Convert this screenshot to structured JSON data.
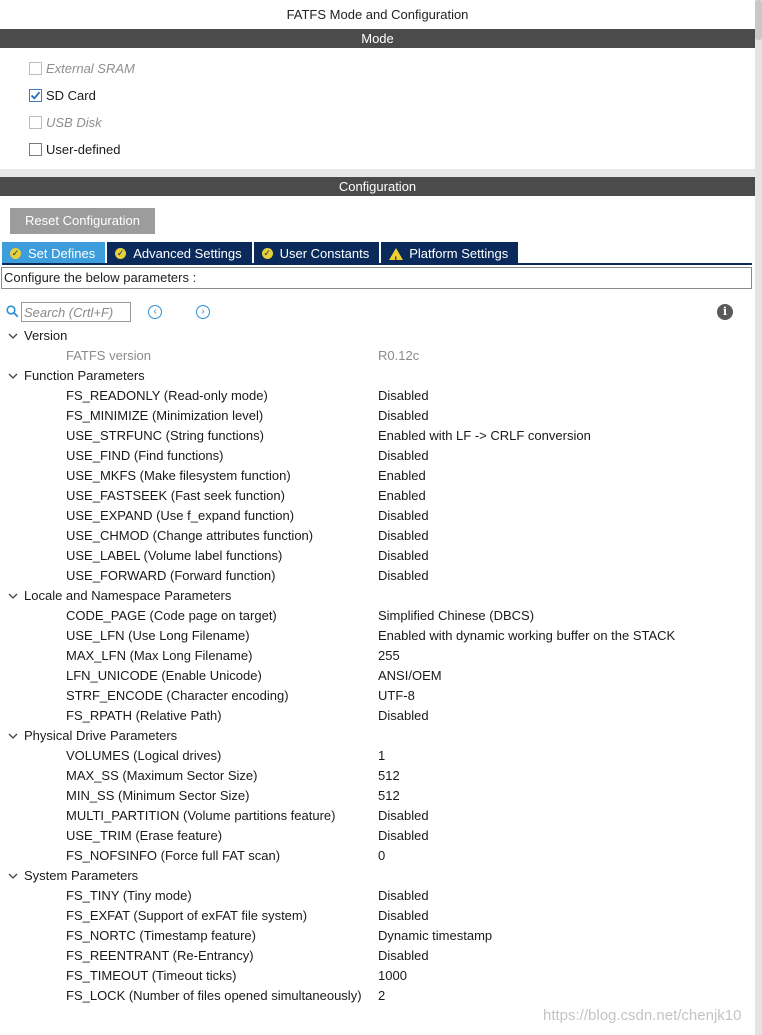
{
  "window": {
    "title": "FATFS Mode and Configuration"
  },
  "mode": {
    "header": "Mode",
    "items": [
      {
        "label": "External SRAM",
        "checked": false,
        "enabled": false
      },
      {
        "label": "SD Card",
        "checked": true,
        "enabled": true
      },
      {
        "label": "USB Disk",
        "checked": false,
        "enabled": false
      },
      {
        "label": "User-defined",
        "checked": false,
        "enabled": true
      }
    ]
  },
  "configuration": {
    "header": "Configuration",
    "reset_label": "Reset Configuration",
    "tabs": [
      {
        "label": "Set Defines",
        "icon": "check-circle-icon",
        "active": true
      },
      {
        "label": "Advanced Settings",
        "icon": "check-circle-icon",
        "active": false
      },
      {
        "label": "User Constants",
        "icon": "check-circle-icon",
        "active": false
      },
      {
        "label": "Platform Settings",
        "icon": "warning-icon",
        "active": false
      }
    ],
    "description": "Configure the below parameters :",
    "search_placeholder": "Search (Crtl+F)"
  },
  "tree": [
    {
      "group": "Version",
      "params": [
        {
          "name": "FATFS version",
          "value": "R0.12c",
          "readonly": true
        }
      ]
    },
    {
      "group": "Function Parameters",
      "params": [
        {
          "name": "FS_READONLY (Read-only mode)",
          "value": "Disabled"
        },
        {
          "name": "FS_MINIMIZE (Minimization level)",
          "value": "Disabled"
        },
        {
          "name": "USE_STRFUNC (String functions)",
          "value": "Enabled with LF -> CRLF conversion"
        },
        {
          "name": "USE_FIND (Find functions)",
          "value": "Disabled"
        },
        {
          "name": "USE_MKFS (Make filesystem function)",
          "value": "Enabled"
        },
        {
          "name": "USE_FASTSEEK (Fast seek function)",
          "value": "Enabled"
        },
        {
          "name": "USE_EXPAND (Use f_expand function)",
          "value": "Disabled"
        },
        {
          "name": "USE_CHMOD (Change attributes function)",
          "value": "Disabled"
        },
        {
          "name": "USE_LABEL (Volume label functions)",
          "value": "Disabled"
        },
        {
          "name": "USE_FORWARD (Forward function)",
          "value": "Disabled"
        }
      ]
    },
    {
      "group": "Locale and Namespace Parameters",
      "params": [
        {
          "name": "CODE_PAGE (Code page on target)",
          "value": "Simplified Chinese (DBCS)"
        },
        {
          "name": "USE_LFN (Use Long Filename)",
          "value": "Enabled with dynamic working buffer on the STACK"
        },
        {
          "name": "MAX_LFN (Max Long Filename)",
          "value": "255"
        },
        {
          "name": "LFN_UNICODE (Enable Unicode)",
          "value": "ANSI/OEM"
        },
        {
          "name": "STRF_ENCODE (Character encoding)",
          "value": "UTF-8"
        },
        {
          "name": "FS_RPATH (Relative Path)",
          "value": "Disabled"
        }
      ]
    },
    {
      "group": "Physical Drive Parameters",
      "params": [
        {
          "name": "VOLUMES (Logical drives)",
          "value": "1"
        },
        {
          "name": "MAX_SS (Maximum Sector Size)",
          "value": "512"
        },
        {
          "name": "MIN_SS (Minimum Sector Size)",
          "value": "512"
        },
        {
          "name": "MULTI_PARTITION (Volume partitions feature)",
          "value": "Disabled"
        },
        {
          "name": "USE_TRIM (Erase feature)",
          "value": "Disabled"
        },
        {
          "name": "FS_NOFSINFO (Force full FAT scan)",
          "value": "0"
        }
      ]
    },
    {
      "group": "System Parameters",
      "params": [
        {
          "name": "FS_TINY (Tiny mode)",
          "value": "Disabled"
        },
        {
          "name": "FS_EXFAT (Support of exFAT file system)",
          "value": "Disabled"
        },
        {
          "name": "FS_NORTC (Timestamp feature)",
          "value": "Dynamic timestamp"
        },
        {
          "name": "FS_REENTRANT (Re-Entrancy)",
          "value": "Disabled"
        },
        {
          "name": "FS_TIMEOUT (Timeout ticks)",
          "value": "1000"
        },
        {
          "name": "FS_LOCK (Number of files opened simultaneously)",
          "value": "2"
        }
      ]
    }
  ],
  "watermark": "https://blog.csdn.net/chenjk10",
  "colors": {
    "section_header": "#4b4b4b",
    "tab_active": "#3d9ddd",
    "tab_inactive": "#0a2a5c",
    "accent": "#2d8fd8"
  }
}
